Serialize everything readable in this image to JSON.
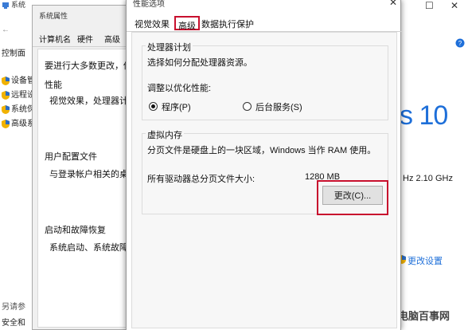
{
  "system_window": {
    "title": "系统",
    "left_items": [
      "控制面",
      "设备管",
      "远程设",
      "系统保",
      "高级系"
    ],
    "bottom_items": [
      "另请参",
      "安全和"
    ],
    "right": {
      "windows_version": "s 10",
      "cpu_speed": "Hz  2.10 GHz",
      "change_settings": "更改设置"
    }
  },
  "system_properties": {
    "title": "系统属性",
    "tabs": [
      "计算机名",
      "硬件",
      "高级"
    ],
    "intro": "要进行大多数更改，你",
    "sections": [
      {
        "title": "性能",
        "desc": "视觉效果，处理器计划"
      },
      {
        "title": "用户配置文件",
        "desc": "与登录帐户相关的桌面"
      },
      {
        "title": "启动和故障恢复",
        "desc": "系统启动、系统故障和"
      }
    ]
  },
  "perf_options": {
    "title": "性能选项",
    "tabs": {
      "visual": "视觉效果",
      "advanced": "高级",
      "dep": "数据执行保护"
    },
    "processor": {
      "legend": "处理器计划",
      "desc": "选择如何分配处理器资源。",
      "adjust_label": "调整以优化性能:",
      "option_programs": "程序(P)",
      "option_services": "后台服务(S)"
    },
    "memory": {
      "legend": "虚拟内存",
      "desc": "分页文件是硬盘上的一块区域，Windows 当作 RAM 使用。",
      "total_label": "所有驱动器总分页文件大小:",
      "total_value": "1280 MB",
      "change_button": "更改(C)..."
    }
  },
  "watermark": "电脑百事网",
  "colors": {
    "highlight": "#c8102e",
    "accent": "#1e6fd9"
  }
}
